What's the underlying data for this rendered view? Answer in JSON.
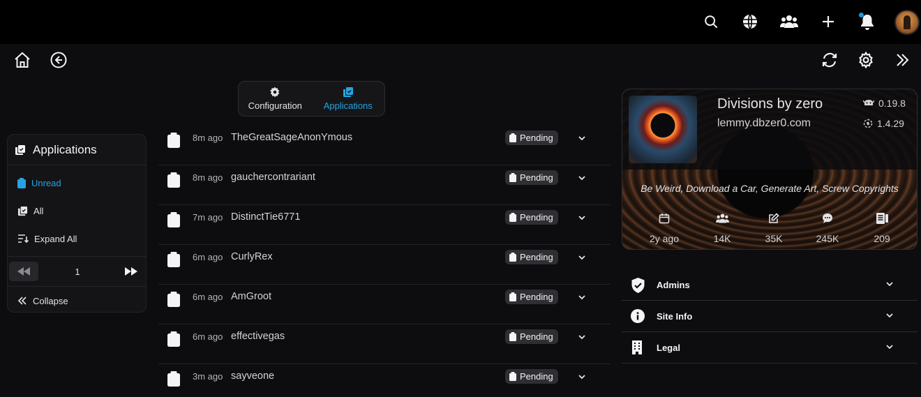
{
  "topbar": {
    "icons": [
      "search-icon",
      "globe-icon",
      "communities-icon",
      "plus-icon",
      "bell-icon"
    ],
    "notification_dot_color": "#1d9bd1",
    "avatar": "user-avatar"
  },
  "nav": {
    "left_icons": [
      "home-icon",
      "back-icon"
    ],
    "right_icons": [
      "refresh-icon",
      "gear-icon",
      "double-chevron-right-icon"
    ]
  },
  "tabs": [
    {
      "label": "Configuration",
      "icon": "gear-icon",
      "active": false
    },
    {
      "label": "Applications",
      "icon": "applications-icon",
      "active": true
    }
  ],
  "sidebar": {
    "title": "Applications",
    "items": [
      {
        "label": "Unread",
        "icon": "clipboard-icon",
        "active": true
      },
      {
        "label": "All",
        "icon": "applications-icon",
        "active": false
      },
      {
        "label": "Expand All",
        "icon": "expand-list-icon",
        "active": false
      }
    ],
    "page": "1",
    "collapse_label": "Collapse"
  },
  "applications": [
    {
      "time": "8m ago",
      "user": "TheGreatSageAnonYmous",
      "status": "Pending"
    },
    {
      "time": "8m ago",
      "user": "gauchercontrariant",
      "status": "Pending"
    },
    {
      "time": "7m ago",
      "user": "DistinctTie6771",
      "status": "Pending"
    },
    {
      "time": "6m ago",
      "user": "CurlyRex",
      "status": "Pending"
    },
    {
      "time": "6m ago",
      "user": "AmGroot",
      "status": "Pending"
    },
    {
      "time": "6m ago",
      "user": "effectivegas",
      "status": "Pending"
    },
    {
      "time": "3m ago",
      "user": "sayveone",
      "status": "Pending"
    }
  ],
  "site": {
    "name": "Divisions by zero",
    "url": "lemmy.dbzer0.com",
    "version_backend": "0.19.8",
    "version_ui": "1.4.29",
    "tagline": "Be Weird, Download a Car, Generate Art, Screw Copyrights",
    "stats": [
      {
        "icon": "calendar-icon",
        "value": "2y ago"
      },
      {
        "icon": "users-icon",
        "value": "14K"
      },
      {
        "icon": "edit-icon",
        "value": "35K"
      },
      {
        "icon": "comment-icon",
        "value": "245K"
      },
      {
        "icon": "communities-list-icon",
        "value": "209"
      }
    ]
  },
  "accordions": [
    {
      "label": "Admins",
      "icon": "shield-check-icon"
    },
    {
      "label": "Site Info",
      "icon": "info-icon"
    },
    {
      "label": "Legal",
      "icon": "building-icon"
    }
  ],
  "colors": {
    "accent": "#27a3e3",
    "background": "#0d0d0f",
    "topbar": "#000000"
  }
}
